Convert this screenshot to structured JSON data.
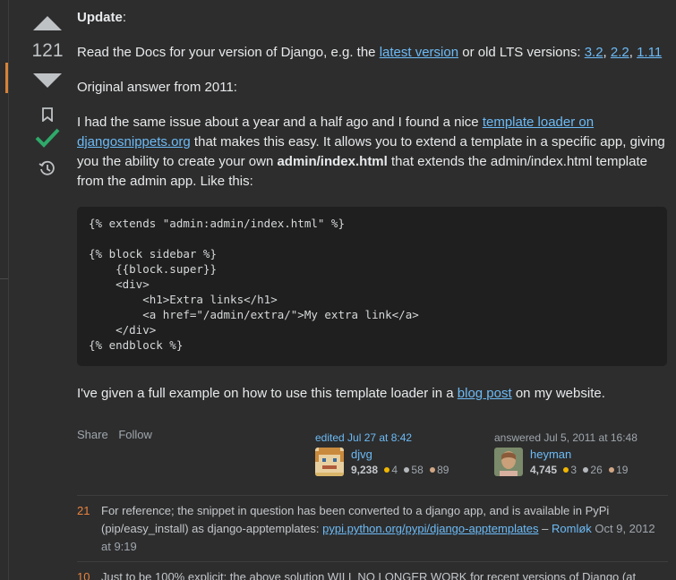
{
  "vote": {
    "count": "121"
  },
  "post": {
    "update_label": "Update",
    "update_colon": ":",
    "p1_pre": "Read the Docs for your version of Django, e.g. the ",
    "p1_link1": "latest version",
    "p1_mid": " or old LTS versions: ",
    "p1_v1": "3.2",
    "p1_sep1": ", ",
    "p1_v2": "2.2",
    "p1_sep2": ", ",
    "p1_v3": "1.11",
    "p2": "Original answer from 2011:",
    "p3_pre": "I had the same issue about a year and a half ago and I found a nice ",
    "p3_link": "template loader on djangosnippets.org",
    "p3_mid": " that makes this easy. It allows you to extend a template in a specific app, giving you the ability to create your own ",
    "p3_bold": "admin/index.html",
    "p3_post": " that extends the admin/index.html template from the admin app. Like this:",
    "code": "{% extends \"admin:admin/index.html\" %}\n\n{% block sidebar %}\n    {{block.super}}\n    <div>\n        <h1>Extra links</h1>\n        <a href=\"/admin/extra/\">My extra link</a>\n    </div>\n{% endblock %}",
    "p4_pre": "I've given a full example on how to use this template loader in a ",
    "p4_link": "blog post",
    "p4_post": " on my website."
  },
  "actions": {
    "share": "Share",
    "follow": "Follow"
  },
  "editor": {
    "when": "edited Jul 27 at 8:42",
    "name": "djvg",
    "rep": "9,238",
    "gold": "4",
    "silver": "58",
    "bronze": "89"
  },
  "author": {
    "when": "answered Jul 5, 2011 at 16:48",
    "name": "heyman",
    "rep": "4,745",
    "gold": "3",
    "silver": "26",
    "bronze": "19"
  },
  "comments": [
    {
      "score": "21",
      "text": "For reference; the snippet in question has been converted to a django app, and is available in PyPi (pip/easy_install) as django-apptemplates: ",
      "link": "pypi.python.org/pypi/django-apptemplates",
      "dash": " – ",
      "author": "Romløk",
      "date": " Oct 9, 2012 at 9:19"
    },
    {
      "score": "10",
      "text": "Just to be 100% explicit: the above solution WILL NO LONGER WORK for recent versions of Django (at"
    }
  ],
  "colors": {
    "accent": "#d8823a",
    "link": "#6cbbf7",
    "accepted": "#2fa96a",
    "gold": "#f1b600",
    "silver": "#b4b8bc",
    "bronze": "#d1a684"
  }
}
